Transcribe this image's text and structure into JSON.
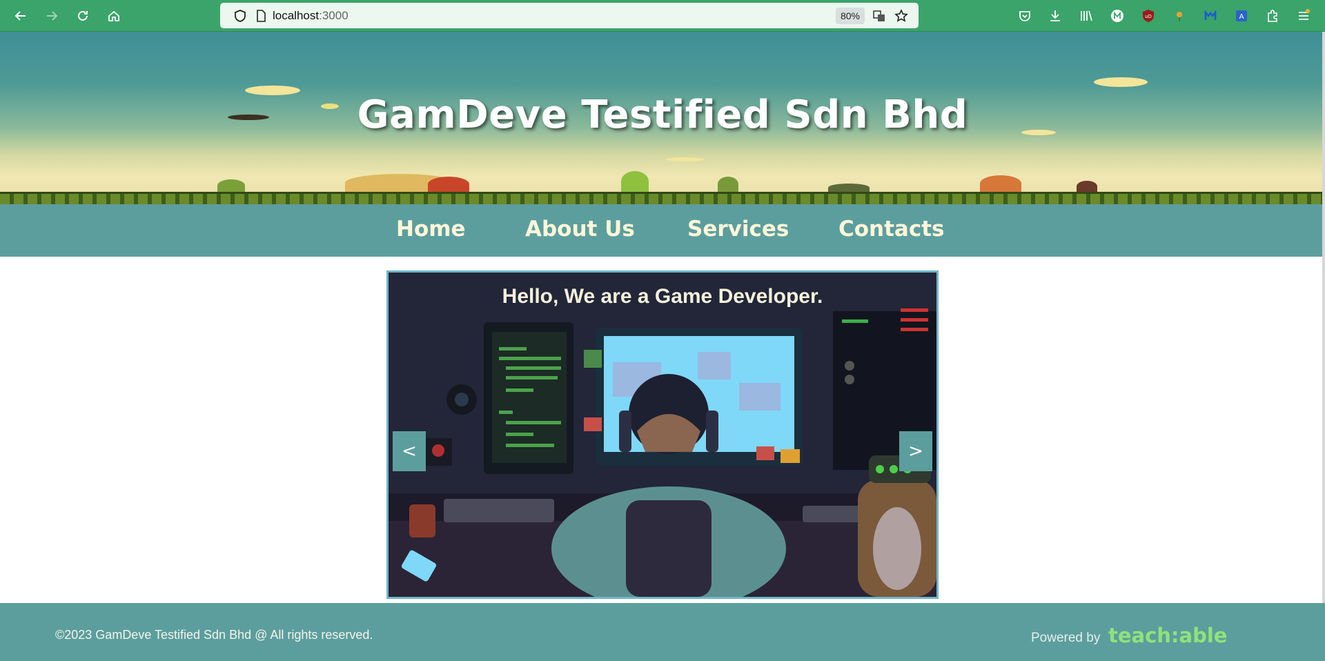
{
  "browser": {
    "url_host": "localhost",
    "url_port": ":3000",
    "zoom": "80%",
    "accent": "#3aa46a"
  },
  "header": {
    "title": "GamDeve Testified Sdn Bhd"
  },
  "nav": {
    "items": [
      {
        "label": "Home"
      },
      {
        "label": "About Us"
      },
      {
        "label": "Services"
      },
      {
        "label": "Contacts"
      }
    ]
  },
  "slideshow": {
    "caption": "Hello, We are a Game Developer.",
    "prev_label": "<",
    "next_label": ">"
  },
  "footer": {
    "copyright": "©2023 GamDeve Testified Sdn Bhd @ All rights reserved.",
    "powered_by": "Powered by",
    "brand": "teach:able"
  },
  "colors": {
    "nav_bg": "#5c9e9e",
    "nav_text": "#fff6d8",
    "brand_green": "#8fe27a"
  }
}
